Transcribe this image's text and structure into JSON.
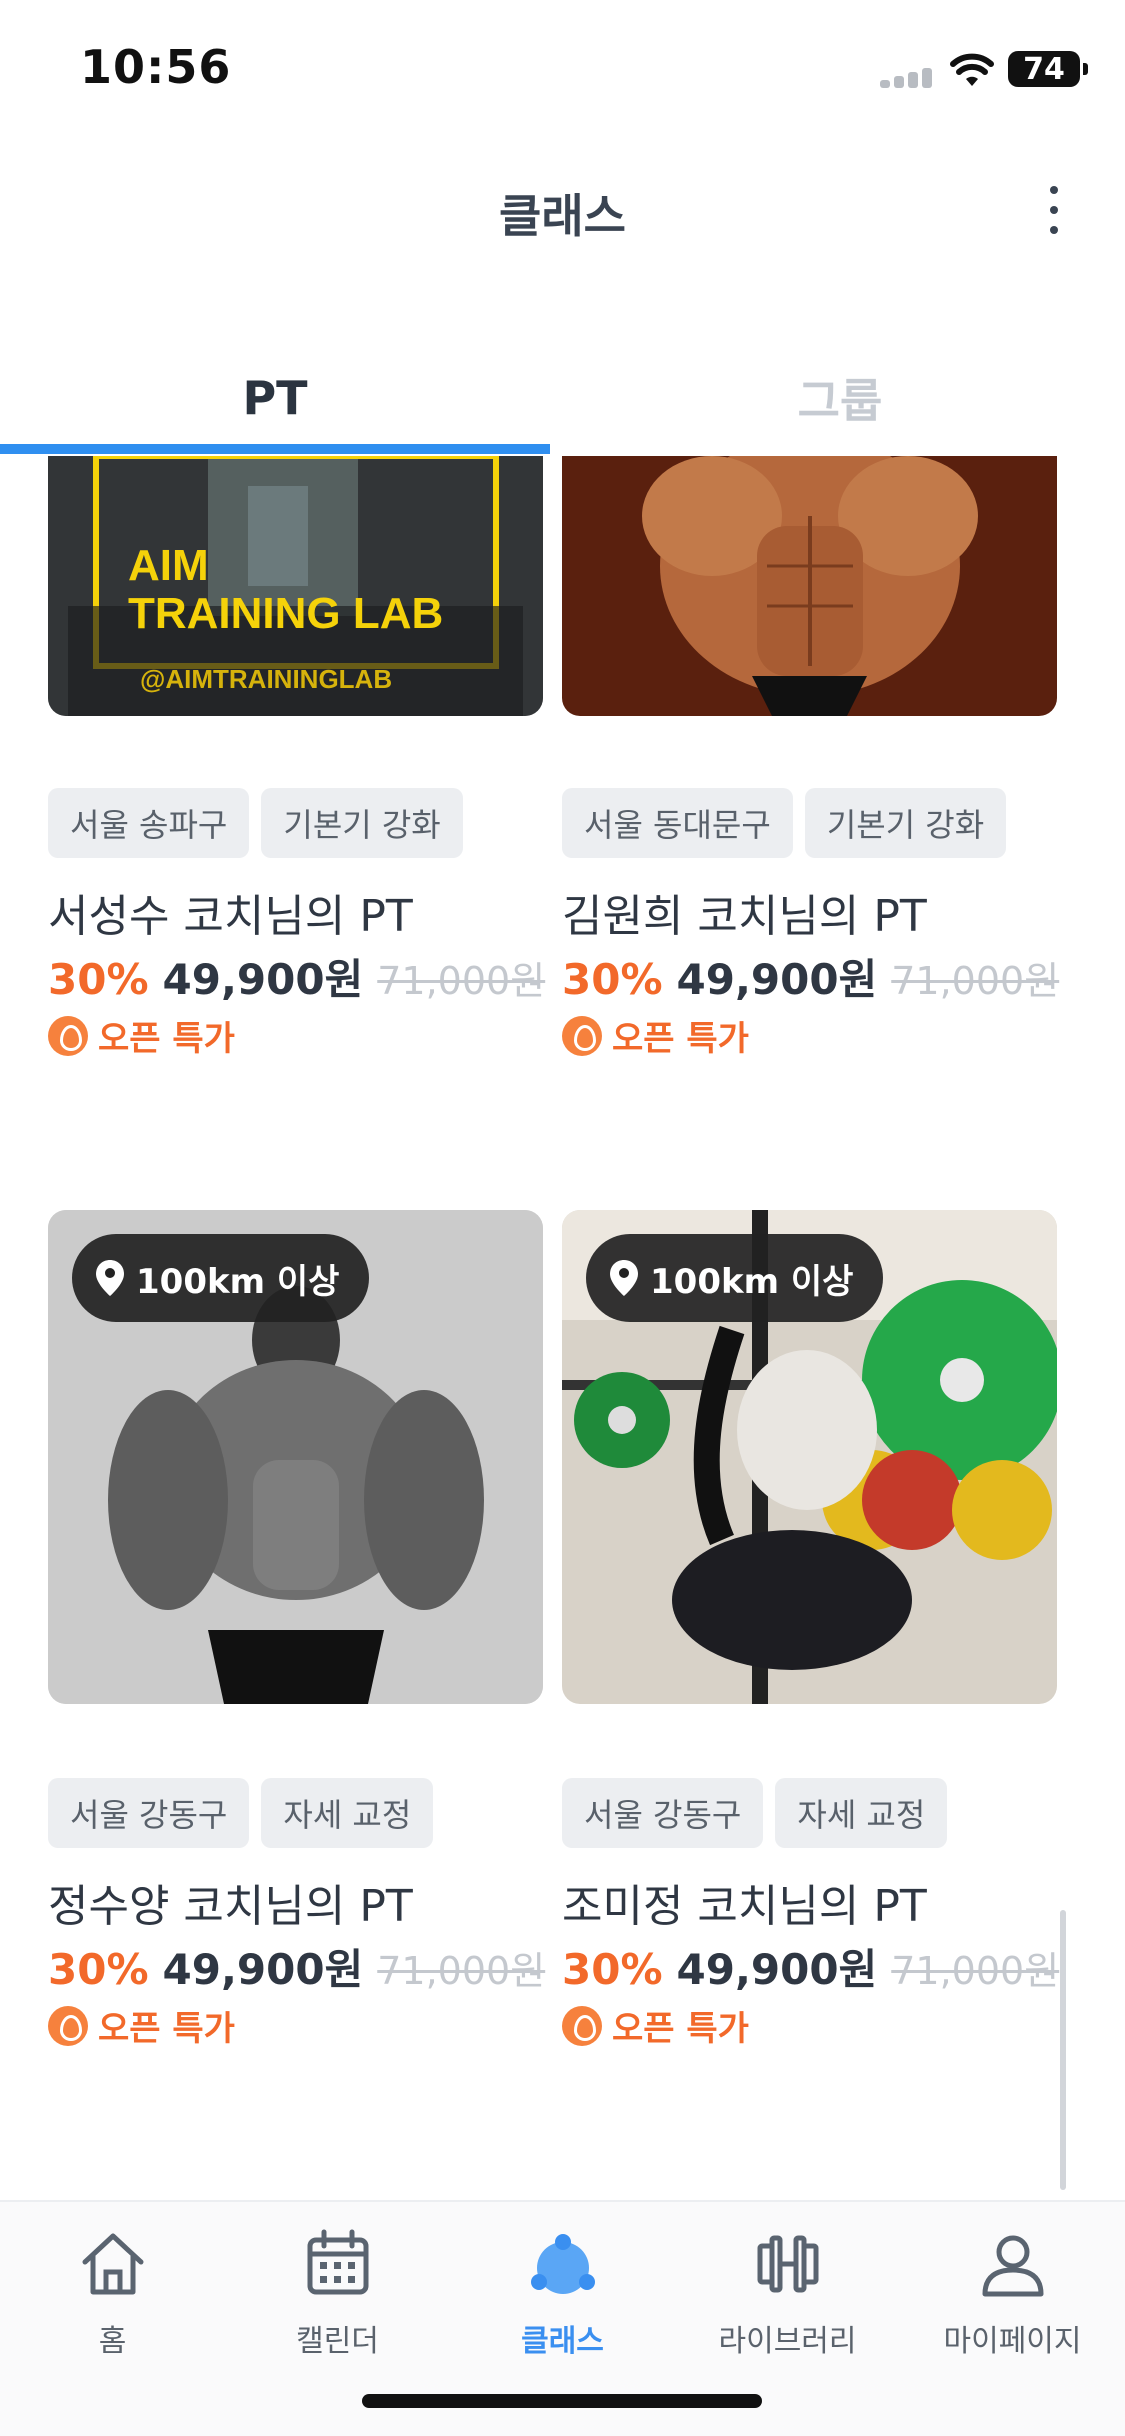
{
  "status_bar": {
    "time": "10:56",
    "battery": "74"
  },
  "header": {
    "title": "클래스"
  },
  "tabs": [
    {
      "label": "PT",
      "active": true
    },
    {
      "label": "그룹",
      "active": false
    }
  ],
  "cards": [
    {
      "tags": [
        "서울 송파구",
        "기본기 강화"
      ],
      "title": "서성수 코치님의 PT",
      "discount": "30%",
      "price": "49,900원",
      "original_price": "71,000원",
      "promo": "오픈 특가",
      "image_text": {
        "line1": "AIM",
        "line2": "TRAINING LAB",
        "handle": "@AIMTRAININGLAB"
      }
    },
    {
      "tags": [
        "서울 동대문구",
        "기본기 강화"
      ],
      "title": "김원희 코치님의 PT",
      "discount": "30%",
      "price": "49,900원",
      "original_price": "71,000원",
      "promo": "오픈 특가"
    },
    {
      "distance": "100km 이상",
      "tags": [
        "서울 강동구",
        "자세 교정"
      ],
      "title": "정수양 코치님의 PT",
      "discount": "30%",
      "price": "49,900원",
      "original_price": "71,000원",
      "promo": "오픈 특가"
    },
    {
      "distance": "100km 이상",
      "tags": [
        "서울 강동구",
        "자세 교정"
      ],
      "title": "조미정 코치님의 PT",
      "discount": "30%",
      "price": "49,900원",
      "original_price": "71,000원",
      "promo": "오픈 특가"
    }
  ],
  "bottom_nav": [
    {
      "label": "홈",
      "icon": "home-icon"
    },
    {
      "label": "캘린더",
      "icon": "calendar-icon"
    },
    {
      "label": "클래스",
      "icon": "class-icon",
      "active": true
    },
    {
      "label": "라이브러리",
      "icon": "dumbbell-icon"
    },
    {
      "label": "마이페이지",
      "icon": "person-icon"
    }
  ],
  "colors": {
    "accent": "#2f8ff0",
    "discount": "#f2692a",
    "tab_inactive": "#c6cbd2"
  }
}
